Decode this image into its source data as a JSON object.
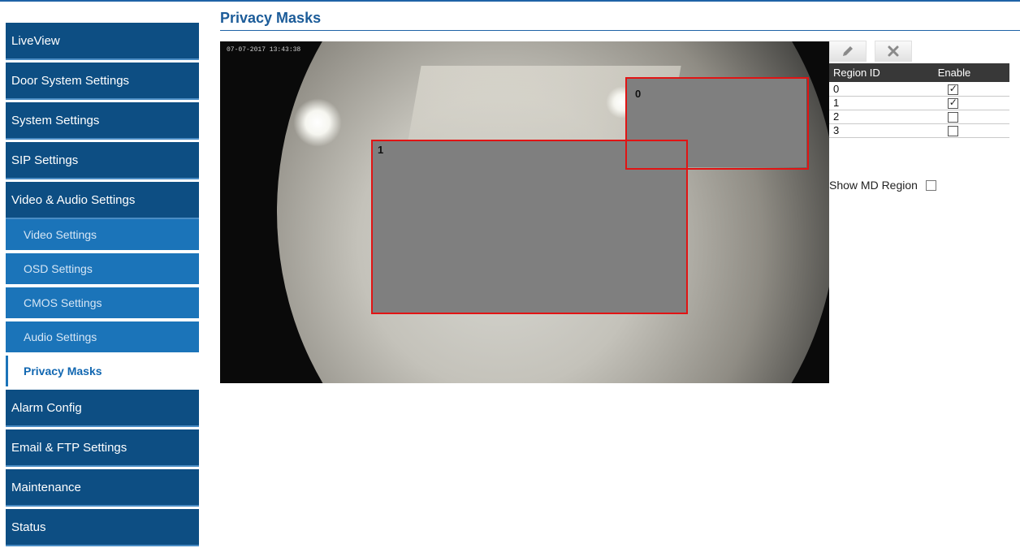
{
  "sidebar": {
    "items": [
      {
        "label": "LiveView"
      },
      {
        "label": "Door System Settings"
      },
      {
        "label": "System Settings"
      },
      {
        "label": "SIP Settings"
      },
      {
        "label": "Video & Audio Settings"
      }
    ],
    "subitems": [
      {
        "label": "Video Settings"
      },
      {
        "label": "OSD Settings"
      },
      {
        "label": "CMOS Settings"
      },
      {
        "label": "Audio Settings"
      },
      {
        "label": "Privacy Masks",
        "active": true
      }
    ],
    "items_after": [
      {
        "label": "Alarm Config"
      },
      {
        "label": "Email & FTP Settings"
      },
      {
        "label": "Maintenance"
      },
      {
        "label": "Status"
      }
    ]
  },
  "header": {
    "title": "Privacy Masks"
  },
  "camera": {
    "timestamp": "07-07-2017 13:43:38",
    "masks": [
      {
        "id": "0",
        "color": "#7f7f7f",
        "border_color": "#e11414"
      },
      {
        "id": "1",
        "color": "#7f7f7f",
        "border_color": "#e11414"
      }
    ]
  },
  "toolbar": {
    "edit_icon": "pencil-icon",
    "delete_icon": "close-icon"
  },
  "region_table": {
    "headers": [
      "Region ID",
      "Enable"
    ],
    "rows": [
      {
        "id": "0",
        "enabled": true
      },
      {
        "id": "1",
        "enabled": true
      },
      {
        "id": "2",
        "enabled": false
      },
      {
        "id": "3",
        "enabled": false
      }
    ]
  },
  "show_md_region": {
    "label": "Show MD Region",
    "checked": false
  },
  "colors": {
    "nav": "#0d4e83",
    "sub_nav": "#1b74b9",
    "title": "#1c5c99",
    "mask_border": "#e11414"
  }
}
